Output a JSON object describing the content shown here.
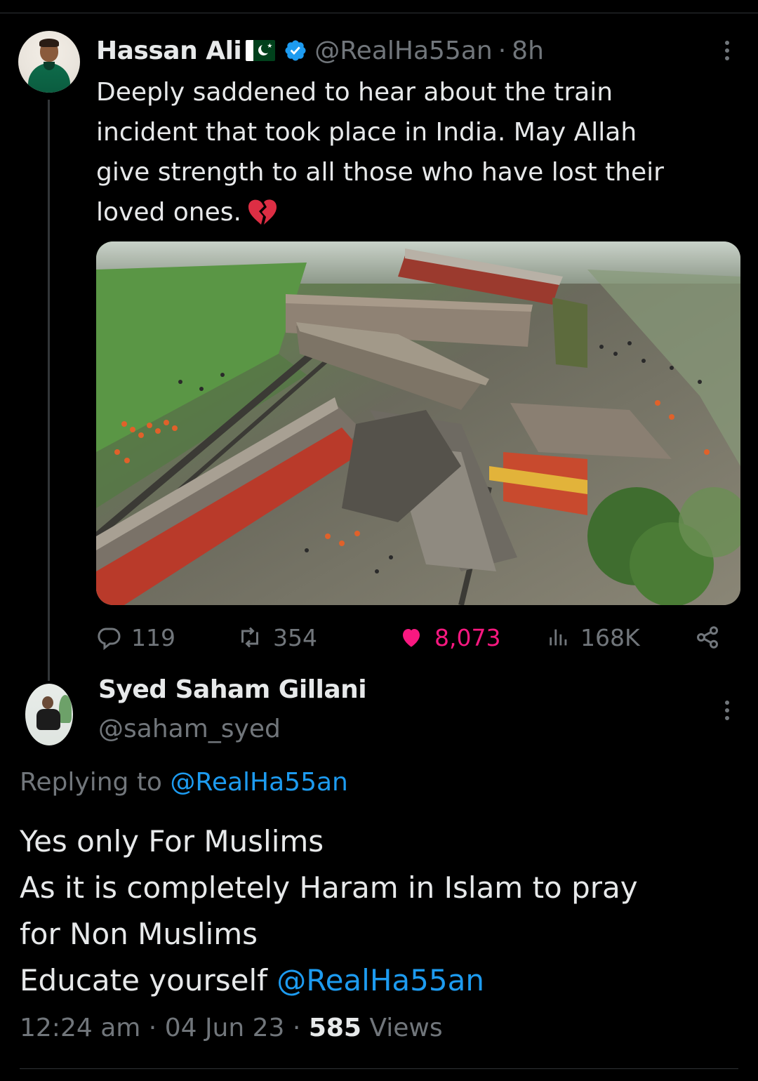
{
  "tweet": {
    "author_name": "Hassan Ali",
    "author_handle": "@RealHa55an",
    "separator": "·",
    "time_ago": "8h",
    "text_lines": [
      "Deeply saddened to hear about the train",
      "incident that took place in India. May Allah",
      "give strength to all those who have lost their",
      "loved ones."
    ],
    "emoji": "broken-heart",
    "flag": "pakistan-flag",
    "stats": {
      "replies": "119",
      "retweets": "354",
      "likes": "8,073",
      "views": "168K"
    },
    "colors": {
      "like_active": "#f91880",
      "verified": "#1d9bf0"
    }
  },
  "reply": {
    "author_name": "Syed Saham Gillani",
    "author_handle": "@saham_syed",
    "replying_label": "Replying to",
    "replying_handle": "@RealHa55an",
    "text_lines": [
      "Yes only For Muslims",
      "As it is completely Haram in Islam to pray",
      "for Non Muslims",
      "Educate yourself"
    ],
    "mention": "@RealHa55an",
    "time": "12:24 am",
    "separator": "·",
    "date": "04 Jun 23",
    "views_count": "585",
    "views_label": "Views"
  },
  "icons": {
    "reply": "reply-icon",
    "retweet": "retweet-icon",
    "like": "like-icon",
    "views": "views-icon",
    "share": "share-icon",
    "more": "more-options-icon",
    "verified": "verified-badge-icon"
  },
  "colors": {
    "background": "#000000",
    "text_primary": "#e7e9ea",
    "text_secondary": "#71767b",
    "link": "#1d9bf0",
    "divider": "#2f3336"
  }
}
